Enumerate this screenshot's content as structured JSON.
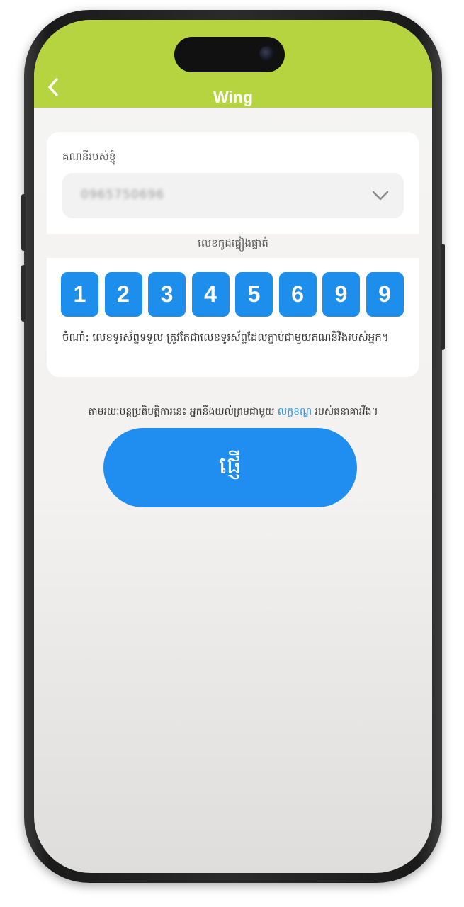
{
  "header": {
    "title": "Wing",
    "color": "#b5d43f",
    "back_icon": "chevron-left-icon"
  },
  "account": {
    "label": "គណនីរបស់ខ្ញុំ",
    "selected_value": "0965750696",
    "dropdown_icon": "chevron-down-icon"
  },
  "code": {
    "label": "លេខកូដផ្ទៀងផ្ទាត់",
    "digits": [
      "1",
      "2",
      "3",
      "4",
      "5",
      "6",
      "9",
      "9"
    ],
    "digit_color": "#1e8eec",
    "note": "ចំណាំ: លេខទូរស័ព្ទទទួល ត្រូវតែជាលេខទូរស័ព្ទដែលភ្ជាប់ជាមួយគណនីវីងរបស់អ្នក។"
  },
  "terms": {
    "prefix": "តាមរយៈបន្តប្រតិបត្តិការនេះ អ្នកនឹងយល់ព្រមជាមួយ ",
    "link": "លក្ខខណ្ឌ",
    "suffix": " របស់ធនាគារវីង។"
  },
  "send_button": {
    "label": "ផ្ញើ",
    "color": "#1f8ef0"
  }
}
